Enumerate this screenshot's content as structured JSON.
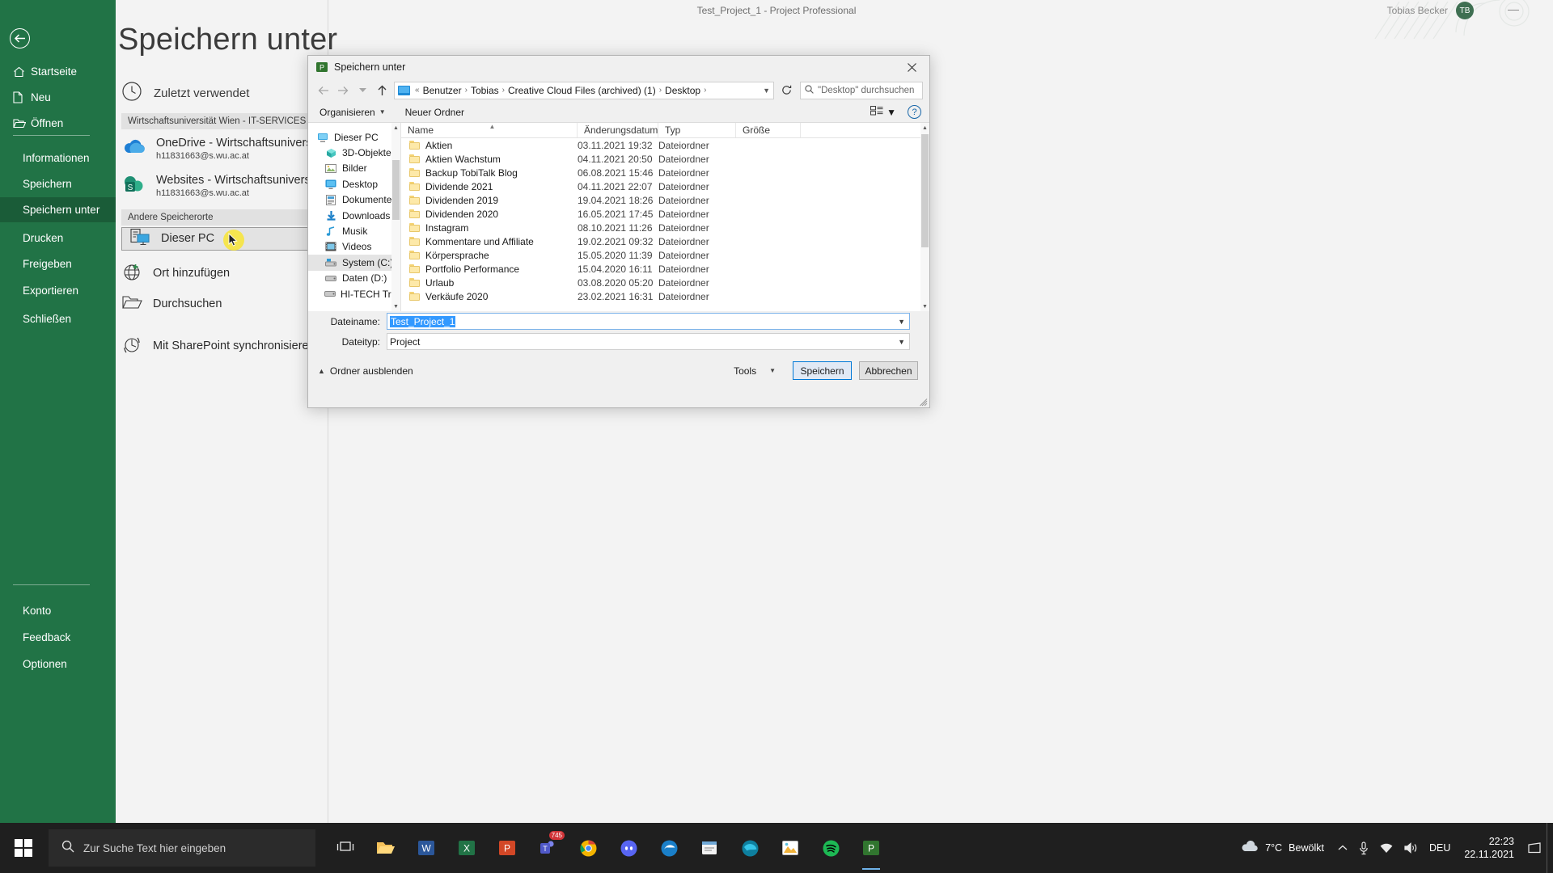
{
  "app": {
    "window_title": "Test_Project_1  -  Project Professional",
    "user_name": "Tobias Becker",
    "user_initials": "TB"
  },
  "backstage": {
    "title": "Speichern unter",
    "back_icon": "back-arrow-icon",
    "nav_items": [
      {
        "label": "Startseite",
        "icon": "home-icon",
        "indented": false,
        "selected": false
      },
      {
        "label": "Neu",
        "icon": "new-document-icon",
        "indented": false,
        "selected": false
      },
      {
        "label": "Öffnen",
        "icon": "open-folder-icon",
        "indented": false,
        "selected": false
      },
      {
        "label": "Informationen",
        "icon": "",
        "indented": true,
        "selected": false
      },
      {
        "label": "Speichern",
        "icon": "",
        "indented": true,
        "selected": false
      },
      {
        "label": "Speichern unter",
        "icon": "",
        "indented": true,
        "selected": true
      },
      {
        "label": "Drucken",
        "icon": "",
        "indented": true,
        "selected": false
      },
      {
        "label": "Freigeben",
        "icon": "",
        "indented": true,
        "selected": false
      },
      {
        "label": "Exportieren",
        "icon": "",
        "indented": true,
        "selected": false
      },
      {
        "label": "Schließen",
        "icon": "",
        "indented": true,
        "selected": false
      }
    ],
    "bottom_items": [
      {
        "label": "Konto"
      },
      {
        "label": "Feedback"
      },
      {
        "label": "Optionen"
      }
    ],
    "recent_label": "Zuletzt verwendet",
    "recent_icon": "clock-icon",
    "category_org": "Wirtschaftsuniversität Wien - IT-SERVICES",
    "category_other": "Andere Speicherorte",
    "locations": [
      {
        "title": "OneDrive - Wirtschaftsuniversit...",
        "subtitle": "h11831663@s.wu.ac.at",
        "icon": "onedrive-icon"
      },
      {
        "title": "Websites - Wirtschaftsuniversit...",
        "subtitle": "h11831663@s.wu.ac.at",
        "icon": "sharepoint-icon"
      }
    ],
    "other_places": [
      {
        "label": "Dieser PC",
        "icon": "this-pc-icon",
        "selected": true
      },
      {
        "label": "Ort hinzufügen",
        "icon": "add-place-icon",
        "selected": false
      },
      {
        "label": "Durchsuchen",
        "icon": "browse-folder-icon",
        "selected": false
      }
    ],
    "sharepoint_sync": {
      "label": "Mit SharePoint synchronisieren",
      "icon": "sharepoint-sync-icon"
    }
  },
  "dialog": {
    "title": "Speichern unter",
    "title_icon": "project-app-icon",
    "close_icon": "close-icon",
    "breadcrumb": {
      "root_icon": "computer-icon",
      "overflow": "«",
      "parts": [
        "Benutzer",
        "Tobias",
        "Creative Cloud Files (archived) (1)",
        "Desktop"
      ],
      "dropdown_icon": "chevron-down-icon"
    },
    "nav_buttons": {
      "back": "back-arrow-icon",
      "forward": "forward-arrow-icon",
      "history": "recent-locations-icon",
      "up": "up-arrow-icon",
      "refresh": "refresh-icon"
    },
    "search": {
      "placeholder": "\"Desktop\" durchsuchen",
      "icon": "search-icon"
    },
    "commands": {
      "organize": "Organisieren",
      "new_folder": "Neuer Ordner",
      "view_icon": "view-mode-icon",
      "help": "?"
    },
    "nav_pane": [
      {
        "label": "Dieser PC",
        "icon": "this-pc-icon",
        "level": 1,
        "selected": false
      },
      {
        "label": "3D-Objekte",
        "icon": "3d-objects-icon",
        "level": 2,
        "selected": false
      },
      {
        "label": "Bilder",
        "icon": "pictures-icon",
        "level": 2,
        "selected": false
      },
      {
        "label": "Desktop",
        "icon": "desktop-icon",
        "level": 2,
        "selected": false
      },
      {
        "label": "Dokumente",
        "icon": "documents-icon",
        "level": 2,
        "selected": false
      },
      {
        "label": "Downloads",
        "icon": "downloads-icon",
        "level": 2,
        "selected": false
      },
      {
        "label": "Musik",
        "icon": "music-icon",
        "level": 2,
        "selected": false
      },
      {
        "label": "Videos",
        "icon": "videos-icon",
        "level": 2,
        "selected": false
      },
      {
        "label": "System (C:)",
        "icon": "system-drive-icon",
        "level": 2,
        "selected": true
      },
      {
        "label": "Daten (D:)",
        "icon": "drive-icon",
        "level": 2,
        "selected": false
      },
      {
        "label": "HI-TECH Treiber",
        "icon": "drive-icon",
        "level": 2,
        "selected": false
      }
    ],
    "columns": [
      {
        "label": "Name",
        "sorted": true,
        "sort_icon": "sort-asc-icon"
      },
      {
        "label": "Änderungsdatum",
        "sorted": false
      },
      {
        "label": "Typ",
        "sorted": false
      },
      {
        "label": "Größe",
        "sorted": false
      }
    ],
    "files": [
      {
        "name": "Aktien",
        "modified": "03.11.2021 19:32",
        "type": "Dateiordner",
        "size": ""
      },
      {
        "name": "Aktien Wachstum",
        "modified": "04.11.2021 20:50",
        "type": "Dateiordner",
        "size": ""
      },
      {
        "name": "Backup TobiTalk Blog",
        "modified": "06.08.2021 15:46",
        "type": "Dateiordner",
        "size": ""
      },
      {
        "name": "Dividende 2021",
        "modified": "04.11.2021 22:07",
        "type": "Dateiordner",
        "size": ""
      },
      {
        "name": "Dividenden 2019",
        "modified": "19.04.2021 18:26",
        "type": "Dateiordner",
        "size": ""
      },
      {
        "name": "Dividenden 2020",
        "modified": "16.05.2021 17:45",
        "type": "Dateiordner",
        "size": ""
      },
      {
        "name": "Instagram",
        "modified": "08.10.2021 11:26",
        "type": "Dateiordner",
        "size": ""
      },
      {
        "name": "Kommentare und Affiliate",
        "modified": "19.02.2021 09:32",
        "type": "Dateiordner",
        "size": ""
      },
      {
        "name": "Körpersprache",
        "modified": "15.05.2020 11:39",
        "type": "Dateiordner",
        "size": ""
      },
      {
        "name": "Portfolio Performance",
        "modified": "15.04.2020 16:11",
        "type": "Dateiordner",
        "size": ""
      },
      {
        "name": "Urlaub",
        "modified": "03.08.2020 05:20",
        "type": "Dateiordner",
        "size": ""
      },
      {
        "name": "Verkäufe 2020",
        "modified": "23.02.2021 16:31",
        "type": "Dateiordner",
        "size": ""
      }
    ],
    "fields": {
      "filename_label": "Dateiname:",
      "filename_value": "Test_Project_1",
      "filetype_label": "Dateityp:",
      "filetype_value": "Project"
    },
    "footer": {
      "hide_folders": "Ordner ausblenden",
      "hide_folders_icon": "chevron-up-icon",
      "tools": "Tools",
      "tools_caret_icon": "chevron-down-icon",
      "save": "Speichern",
      "cancel": "Abbrechen"
    }
  },
  "taskbar": {
    "start_icon": "windows-start-icon",
    "search_placeholder": "Zur Suche Text hier eingeben",
    "search_icon": "search-icon",
    "task_view_icon": "task-view-icon",
    "apps": [
      {
        "name": "file-explorer-icon",
        "active": false
      },
      {
        "name": "word-icon",
        "active": false
      },
      {
        "name": "excel-icon",
        "active": false
      },
      {
        "name": "powerpoint-icon",
        "active": false
      },
      {
        "name": "teams-icon",
        "active": false,
        "badge": "745"
      },
      {
        "name": "chrome-icon",
        "active": false
      },
      {
        "name": "discord-icon",
        "active": false
      },
      {
        "name": "edge-legacy-icon",
        "active": false
      },
      {
        "name": "notes-icon",
        "active": false
      },
      {
        "name": "edge-icon",
        "active": false
      },
      {
        "name": "photos-icon",
        "active": false
      },
      {
        "name": "spotify-icon",
        "active": false
      },
      {
        "name": "project-icon",
        "active": true
      }
    ],
    "tray": {
      "weather_temp": "7°C",
      "weather_desc": "Bewölkt",
      "weather_icon": "cloud-icon",
      "chevron_icon": "show-hidden-icons-icon",
      "mic_icon": "microphone-icon",
      "network_icon": "network-icon",
      "volume_icon": "volume-icon",
      "language": "DEU",
      "time": "22:23",
      "date": "22.11.2021",
      "action_center_icon": "action-center-icon"
    }
  }
}
